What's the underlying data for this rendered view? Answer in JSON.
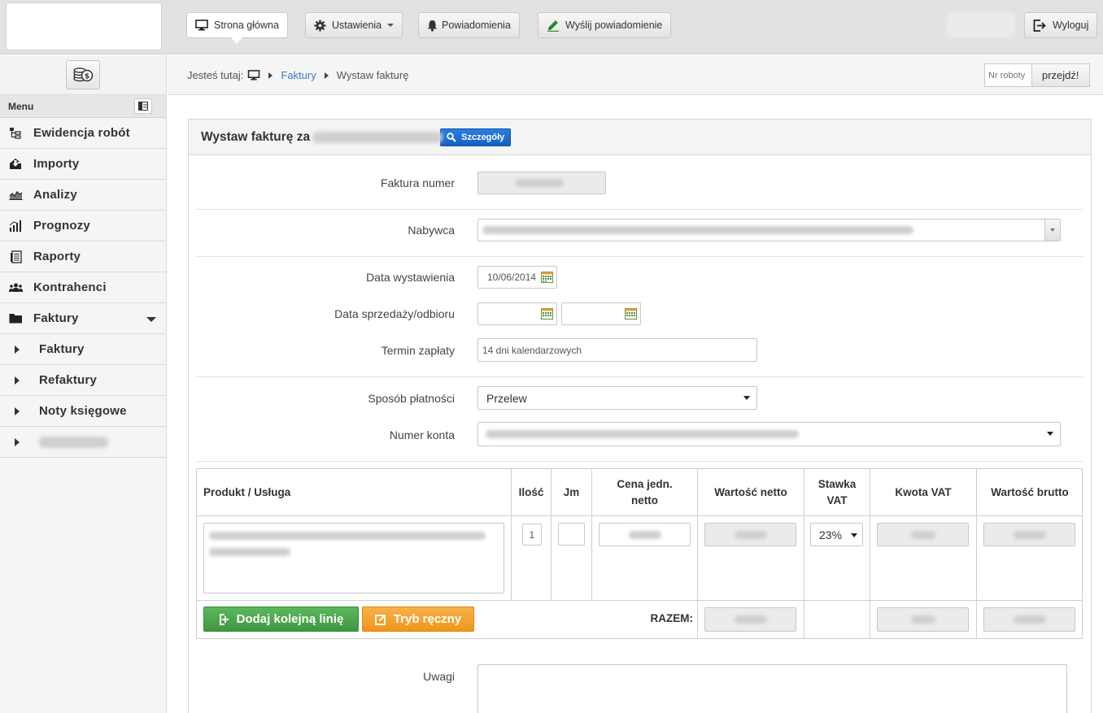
{
  "nav": {
    "home": "Strona główna",
    "settings": "Ustawienia",
    "notifications": "Powiadomienia",
    "send_notification": "Wyślij powiadomienie",
    "logout": "Wyloguj"
  },
  "sidebar": {
    "menu_label": "Menu",
    "items": [
      {
        "label": "Ewidencja robót",
        "icon": "flowchart-icon"
      },
      {
        "label": "Importy",
        "icon": "download-box-icon"
      },
      {
        "label": "Analizy",
        "icon": "area-chart-icon"
      },
      {
        "label": "Prognozy",
        "icon": "bar-chart-icon"
      },
      {
        "label": "Raporty",
        "icon": "document-icon"
      },
      {
        "label": "Kontrahenci",
        "icon": "users-icon"
      },
      {
        "label": "Faktury",
        "icon": "folder-icon"
      }
    ],
    "subitems": [
      "Faktury",
      "Refaktury",
      "Noty księgowe"
    ]
  },
  "breadcrumb": {
    "prefix": "Jesteś tutaj:",
    "link": "Faktury",
    "current": "Wystaw fakturę"
  },
  "robot_search": {
    "placeholder": "Nr roboty",
    "button": "przejdź!"
  },
  "panel": {
    "title": "Wystaw fakturę za",
    "details_button": "Szczegóły"
  },
  "form": {
    "invoice_number_label": "Faktura numer",
    "buyer_label": "Nabywca",
    "issue_date_label": "Data wystawienia",
    "issue_date_value": "10/06/2014",
    "sale_date_label": "Data sprzedaży/odbioru",
    "payment_term_label": "Termin zapłaty",
    "payment_term_value": "14 dni kalendarzowych",
    "payment_method_label": "Sposób płatności",
    "payment_method_value": "Przelew",
    "account_label": "Numer konta",
    "notes_label": "Uwagi"
  },
  "table": {
    "headers": {
      "product": "Produkt / Usługa",
      "qty": "Ilość",
      "unit": "Jm",
      "unit_price_1": "Cena jedn.",
      "unit_price_2": "netto",
      "net_value": "Wartość netto",
      "vat_rate_1": "Stawka",
      "vat_rate_2": "VAT",
      "vat_amount": "Kwota VAT",
      "gross_value": "Wartość brutto"
    },
    "row": {
      "qty": "1",
      "vat_rate": "23%"
    },
    "add_line_button": "Dodaj kolejną linię",
    "manual_mode_button": "Tryb ręczny",
    "total_label": "RAZEM:"
  }
}
